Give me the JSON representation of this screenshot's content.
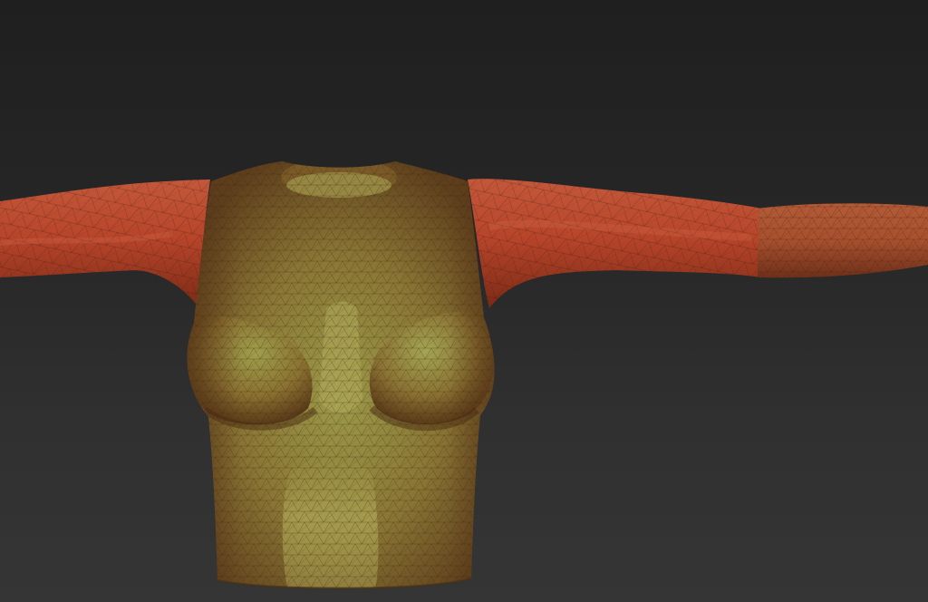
{
  "viewport": {
    "background_top": "#1f1f1f",
    "background_bottom": "#353535"
  },
  "mesh": {
    "torso_color": "#8a7a3a",
    "torso_highlight": "#a4a452",
    "torso_shadow": "#5a3e1c",
    "sleeve_color": "#c44a2a",
    "sleeve_highlight": "#d8603a",
    "sleeve_shadow": "#7a2a16",
    "wire_color": "#3a2410",
    "polygroups": [
      "torso",
      "left-sleeve",
      "right-sleeve",
      "right-forearm"
    ]
  }
}
